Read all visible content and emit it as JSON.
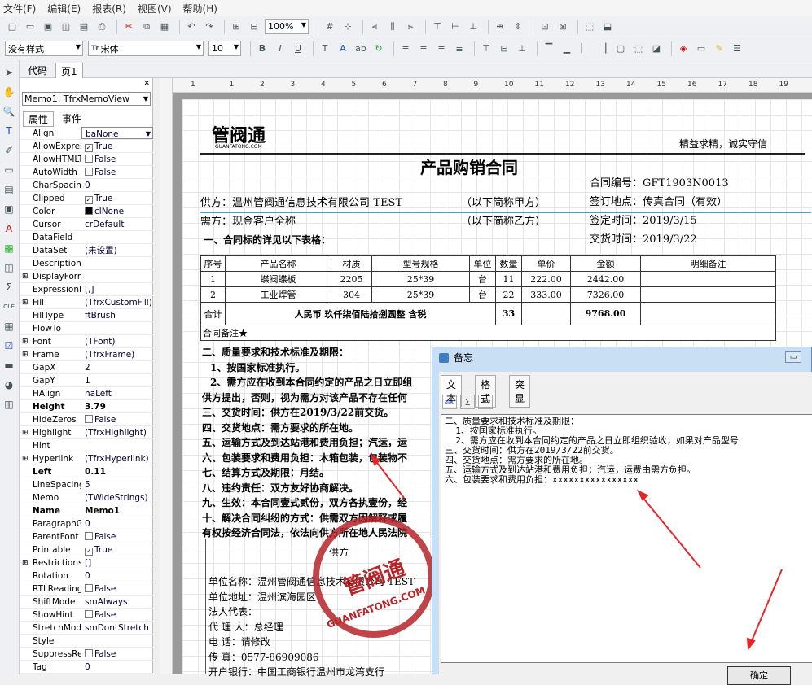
{
  "menu": [
    "文件(F)",
    "编辑(E)",
    "报表(R)",
    "视图(V)",
    "帮助(H)"
  ],
  "toolbar": {
    "zoom": "100%",
    "style": "没有样式",
    "font": "宋体",
    "size": "10",
    "font_prefix": "Tr"
  },
  "tabs": {
    "code": "代码",
    "page": "页1"
  },
  "inspector": {
    "selected": "Memo1: TfrxMemoView",
    "tab_props": "属性",
    "tab_events": "事件",
    "props": [
      {
        "n": "Align",
        "v": "baNone",
        "t": "combo"
      },
      {
        "n": "AllowExpress",
        "v": "True",
        "t": "check",
        "c": true
      },
      {
        "n": "AllowHTMLTa",
        "v": "False",
        "t": "check",
        "c": false
      },
      {
        "n": "AutoWidth",
        "v": "False",
        "t": "check",
        "c": false
      },
      {
        "n": "CharSpacing",
        "v": "0"
      },
      {
        "n": "Clipped",
        "v": "True",
        "t": "check",
        "c": true
      },
      {
        "n": "Color",
        "v": "clNone",
        "t": "color"
      },
      {
        "n": "Cursor",
        "v": "crDefault"
      },
      {
        "n": "DataField",
        "v": ""
      },
      {
        "n": "DataSet",
        "v": "(未设置)"
      },
      {
        "n": "Description",
        "v": ""
      },
      {
        "n": "DisplayForma",
        "v": "",
        "e": true
      },
      {
        "n": "ExpressionDe",
        "v": "[,]"
      },
      {
        "n": "Fill",
        "v": "(TfrxCustomFill)",
        "e": true
      },
      {
        "n": "FillType",
        "v": "ftBrush"
      },
      {
        "n": "FlowTo",
        "v": ""
      },
      {
        "n": "Font",
        "v": "(TFont)",
        "e": true
      },
      {
        "n": "Frame",
        "v": "(TfrxFrame)",
        "e": true
      },
      {
        "n": "GapX",
        "v": "2"
      },
      {
        "n": "GapY",
        "v": "1"
      },
      {
        "n": "HAlign",
        "v": "haLeft"
      },
      {
        "n": "Height",
        "v": "3.79",
        "b": true
      },
      {
        "n": "HideZeros",
        "v": "False",
        "t": "check",
        "c": false
      },
      {
        "n": "Highlight",
        "v": "(TfrxHighlight)",
        "e": true
      },
      {
        "n": "Hint",
        "v": ""
      },
      {
        "n": "Hyperlink",
        "v": "(TfrxHyperlink)",
        "e": true
      },
      {
        "n": "Left",
        "v": "0.11",
        "b": true
      },
      {
        "n": "LineSpacing",
        "v": "5"
      },
      {
        "n": "Memo",
        "v": "(TWideStrings)"
      },
      {
        "n": "Name",
        "v": "Memo1",
        "b": true
      },
      {
        "n": "ParagraphGa",
        "v": "0"
      },
      {
        "n": "ParentFont",
        "v": "False",
        "t": "check",
        "c": false
      },
      {
        "n": "Printable",
        "v": "True",
        "t": "check",
        "c": true
      },
      {
        "n": "Restrictions",
        "v": "[]",
        "e": true
      },
      {
        "n": "Rotation",
        "v": "0"
      },
      {
        "n": "RTLReading",
        "v": "False",
        "t": "check",
        "c": false
      },
      {
        "n": "ShiftMode",
        "v": "smAlways"
      },
      {
        "n": "ShowHint",
        "v": "False",
        "t": "check",
        "c": false
      },
      {
        "n": "StretchMode",
        "v": "smDontStretch"
      },
      {
        "n": "Style",
        "v": ""
      },
      {
        "n": "SuppressRep",
        "v": "False",
        "t": "check",
        "c": false
      },
      {
        "n": "Tag",
        "v": "0"
      }
    ]
  },
  "ruler": [
    "1",
    "1",
    "2",
    "3",
    "4",
    "5",
    "6",
    "7",
    "8",
    "9",
    "10",
    "11",
    "12",
    "13",
    "14",
    "15",
    "16",
    "17",
    "18",
    "19"
  ],
  "report": {
    "logo": "管阀通",
    "logo_sub": "GUANFATONG.COM",
    "slogan": "精益求精，诚实守信",
    "title": "产品购销合同",
    "contract_no": "合同编号：GFT1903N0013",
    "sign_place": "签订地点：传真合同（有效）",
    "sign_date": "签定时间：2019/3/15",
    "deliver_date": "交货时间：2019/3/22",
    "supplier": "供方：温州管阀通信息技术有限公司-TEST",
    "supplier_alias": "（以下简称甲方）",
    "buyer": "需方：现金客户全称",
    "buyer_alias": "（以下简称乙方）",
    "section1": "一、合同标的详见以下表格：",
    "headers": [
      "序号",
      "产品名称",
      "材质",
      "型号规格",
      "单位",
      "数量",
      "单价",
      "金额",
      "明细备注"
    ],
    "rows": [
      [
        "1",
        "蝶阀蝶板",
        "2205",
        "25*39",
        "台",
        "11",
        "222.00",
        "2442.00",
        ""
      ],
      [
        "2",
        "工业焊管",
        "304",
        "25*39",
        "台",
        "22",
        "333.00",
        "7326.00",
        ""
      ]
    ],
    "total_label": "合计",
    "total_words": "人民币 玖仟柒佰陆拾捌圆整 含税",
    "total_qty": "33",
    "total_amount": "9768.00",
    "remark": "合同备注★",
    "terms": [
      "二、质量要求和技术标准及期限：",
      "1、按国家标准执行。",
      "2、需方应在收到本合同约定的产品之日立即组",
      "供方提出，否则，视为需方对该产品不存在任何",
      "三、交货时间：供方在2019/3/22前交货。",
      "四、交货地点：需方要求的所在地。",
      "五、运输方式及到达站港和费用负担；汽运，运",
      "六、包装要求和费用负担：木箱包装，包装物不",
      "七、结算方式及期限：月结。",
      "八、违约责任：双方友好协商解决。",
      "九、生效：本合同壹式贰份，双方各执壹份，经",
      "十、解决合同纠纷的方式：供需双方因解释或履",
      "有权按经济合同法，依法向供方所在地人民法院"
    ],
    "party_title": "供方",
    "party": [
      "单位名称：温州管阀通信息技术有限公司-TEST",
      "单位地址：温州滨海园区",
      "法人代表：",
      "代 理 人：总经理",
      "电    话：请修改",
      "传    真：0577-86909086",
      "开户银行：中国工商银行温州市龙湾支行"
    ],
    "stamp": "管阀通",
    "stamp_sub": "GUANFATONG.COM"
  },
  "dialog": {
    "title": "备忘",
    "tabs": [
      "文本",
      "格式",
      "突显"
    ],
    "memo": "二、质量要求和技术标准及期限：\n  1、按国家标准执行。\n  2、需方应在收到本合同约定的产品之日立即组织验收，如果对产品型号\n三、交货时间：供方在2019/3/22前交货。\n四、交货地点：需方要求的所在地。\n五、运输方式及到达站港和费用负担；汽运，运费由需方负担。\n六、包装要求和费用负担：xxxxxxxxxxxxxxxx",
    "ok": "确定"
  }
}
